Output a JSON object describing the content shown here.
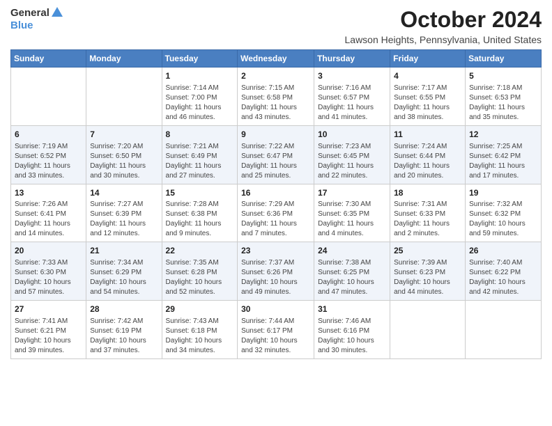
{
  "header": {
    "logo_general": "General",
    "logo_blue": "Blue",
    "month": "October 2024",
    "location": "Lawson Heights, Pennsylvania, United States"
  },
  "days_of_week": [
    "Sunday",
    "Monday",
    "Tuesday",
    "Wednesday",
    "Thursday",
    "Friday",
    "Saturday"
  ],
  "weeks": [
    [
      {
        "day": "",
        "sunrise": "",
        "sunset": "",
        "daylight": ""
      },
      {
        "day": "",
        "sunrise": "",
        "sunset": "",
        "daylight": ""
      },
      {
        "day": "1",
        "sunrise": "Sunrise: 7:14 AM",
        "sunset": "Sunset: 7:00 PM",
        "daylight": "Daylight: 11 hours and 46 minutes."
      },
      {
        "day": "2",
        "sunrise": "Sunrise: 7:15 AM",
        "sunset": "Sunset: 6:58 PM",
        "daylight": "Daylight: 11 hours and 43 minutes."
      },
      {
        "day": "3",
        "sunrise": "Sunrise: 7:16 AM",
        "sunset": "Sunset: 6:57 PM",
        "daylight": "Daylight: 11 hours and 41 minutes."
      },
      {
        "day": "4",
        "sunrise": "Sunrise: 7:17 AM",
        "sunset": "Sunset: 6:55 PM",
        "daylight": "Daylight: 11 hours and 38 minutes."
      },
      {
        "day": "5",
        "sunrise": "Sunrise: 7:18 AM",
        "sunset": "Sunset: 6:53 PM",
        "daylight": "Daylight: 11 hours and 35 minutes."
      }
    ],
    [
      {
        "day": "6",
        "sunrise": "Sunrise: 7:19 AM",
        "sunset": "Sunset: 6:52 PM",
        "daylight": "Daylight: 11 hours and 33 minutes."
      },
      {
        "day": "7",
        "sunrise": "Sunrise: 7:20 AM",
        "sunset": "Sunset: 6:50 PM",
        "daylight": "Daylight: 11 hours and 30 minutes."
      },
      {
        "day": "8",
        "sunrise": "Sunrise: 7:21 AM",
        "sunset": "Sunset: 6:49 PM",
        "daylight": "Daylight: 11 hours and 27 minutes."
      },
      {
        "day": "9",
        "sunrise": "Sunrise: 7:22 AM",
        "sunset": "Sunset: 6:47 PM",
        "daylight": "Daylight: 11 hours and 25 minutes."
      },
      {
        "day": "10",
        "sunrise": "Sunrise: 7:23 AM",
        "sunset": "Sunset: 6:45 PM",
        "daylight": "Daylight: 11 hours and 22 minutes."
      },
      {
        "day": "11",
        "sunrise": "Sunrise: 7:24 AM",
        "sunset": "Sunset: 6:44 PM",
        "daylight": "Daylight: 11 hours and 20 minutes."
      },
      {
        "day": "12",
        "sunrise": "Sunrise: 7:25 AM",
        "sunset": "Sunset: 6:42 PM",
        "daylight": "Daylight: 11 hours and 17 minutes."
      }
    ],
    [
      {
        "day": "13",
        "sunrise": "Sunrise: 7:26 AM",
        "sunset": "Sunset: 6:41 PM",
        "daylight": "Daylight: 11 hours and 14 minutes."
      },
      {
        "day": "14",
        "sunrise": "Sunrise: 7:27 AM",
        "sunset": "Sunset: 6:39 PM",
        "daylight": "Daylight: 11 hours and 12 minutes."
      },
      {
        "day": "15",
        "sunrise": "Sunrise: 7:28 AM",
        "sunset": "Sunset: 6:38 PM",
        "daylight": "Daylight: 11 hours and 9 minutes."
      },
      {
        "day": "16",
        "sunrise": "Sunrise: 7:29 AM",
        "sunset": "Sunset: 6:36 PM",
        "daylight": "Daylight: 11 hours and 7 minutes."
      },
      {
        "day": "17",
        "sunrise": "Sunrise: 7:30 AM",
        "sunset": "Sunset: 6:35 PM",
        "daylight": "Daylight: 11 hours and 4 minutes."
      },
      {
        "day": "18",
        "sunrise": "Sunrise: 7:31 AM",
        "sunset": "Sunset: 6:33 PM",
        "daylight": "Daylight: 11 hours and 2 minutes."
      },
      {
        "day": "19",
        "sunrise": "Sunrise: 7:32 AM",
        "sunset": "Sunset: 6:32 PM",
        "daylight": "Daylight: 10 hours and 59 minutes."
      }
    ],
    [
      {
        "day": "20",
        "sunrise": "Sunrise: 7:33 AM",
        "sunset": "Sunset: 6:30 PM",
        "daylight": "Daylight: 10 hours and 57 minutes."
      },
      {
        "day": "21",
        "sunrise": "Sunrise: 7:34 AM",
        "sunset": "Sunset: 6:29 PM",
        "daylight": "Daylight: 10 hours and 54 minutes."
      },
      {
        "day": "22",
        "sunrise": "Sunrise: 7:35 AM",
        "sunset": "Sunset: 6:28 PM",
        "daylight": "Daylight: 10 hours and 52 minutes."
      },
      {
        "day": "23",
        "sunrise": "Sunrise: 7:37 AM",
        "sunset": "Sunset: 6:26 PM",
        "daylight": "Daylight: 10 hours and 49 minutes."
      },
      {
        "day": "24",
        "sunrise": "Sunrise: 7:38 AM",
        "sunset": "Sunset: 6:25 PM",
        "daylight": "Daylight: 10 hours and 47 minutes."
      },
      {
        "day": "25",
        "sunrise": "Sunrise: 7:39 AM",
        "sunset": "Sunset: 6:23 PM",
        "daylight": "Daylight: 10 hours and 44 minutes."
      },
      {
        "day": "26",
        "sunrise": "Sunrise: 7:40 AM",
        "sunset": "Sunset: 6:22 PM",
        "daylight": "Daylight: 10 hours and 42 minutes."
      }
    ],
    [
      {
        "day": "27",
        "sunrise": "Sunrise: 7:41 AM",
        "sunset": "Sunset: 6:21 PM",
        "daylight": "Daylight: 10 hours and 39 minutes."
      },
      {
        "day": "28",
        "sunrise": "Sunrise: 7:42 AM",
        "sunset": "Sunset: 6:19 PM",
        "daylight": "Daylight: 10 hours and 37 minutes."
      },
      {
        "day": "29",
        "sunrise": "Sunrise: 7:43 AM",
        "sunset": "Sunset: 6:18 PM",
        "daylight": "Daylight: 10 hours and 34 minutes."
      },
      {
        "day": "30",
        "sunrise": "Sunrise: 7:44 AM",
        "sunset": "Sunset: 6:17 PM",
        "daylight": "Daylight: 10 hours and 32 minutes."
      },
      {
        "day": "31",
        "sunrise": "Sunrise: 7:46 AM",
        "sunset": "Sunset: 6:16 PM",
        "daylight": "Daylight: 10 hours and 30 minutes."
      },
      {
        "day": "",
        "sunrise": "",
        "sunset": "",
        "daylight": ""
      },
      {
        "day": "",
        "sunrise": "",
        "sunset": "",
        "daylight": ""
      }
    ]
  ]
}
